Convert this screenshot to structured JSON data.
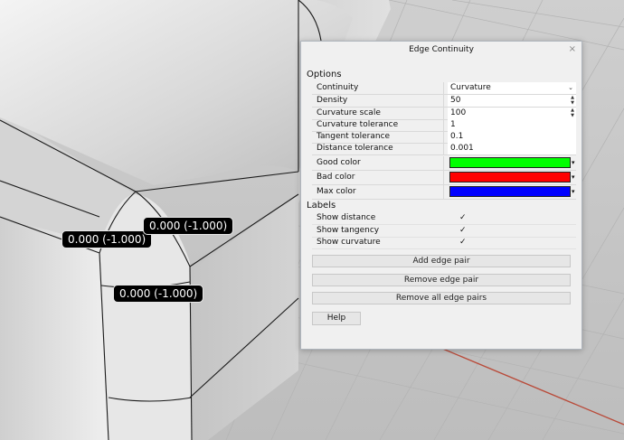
{
  "viewport": {
    "labels": [
      "0.000 (-1.000)",
      "0.000 (-1.000)",
      "0.000 (-1.000)"
    ]
  },
  "dialog": {
    "title": "Edge Continuity",
    "close_glyph": "×",
    "options_header": "Options",
    "options": [
      {
        "label": "Continuity",
        "value": "Curvature",
        "control": "dropdown"
      },
      {
        "label": "Density",
        "value": "50",
        "control": "spinner"
      },
      {
        "label": "Curvature scale",
        "value": "100",
        "control": "spinner"
      },
      {
        "label": "Curvature tolerance",
        "value": "1",
        "control": "text"
      },
      {
        "label": "Tangent tolerance",
        "value": "0.1",
        "control": "text"
      },
      {
        "label": "Distance tolerance",
        "value": "0.001",
        "control": "text"
      }
    ],
    "colors": [
      {
        "label": "Good color",
        "color": "#00ff00"
      },
      {
        "label": "Bad color",
        "color": "#ff0000"
      },
      {
        "label": "Max color",
        "color": "#0000ff"
      }
    ],
    "labels_header": "Labels",
    "labels": [
      {
        "label": "Show distance",
        "checked": true
      },
      {
        "label": "Show tangency",
        "checked": true
      },
      {
        "label": "Show curvature",
        "checked": true
      }
    ],
    "buttons": {
      "add": "Add edge pair",
      "remove": "Remove edge pair",
      "remove_all": "Remove all edge pairs",
      "help": "Help"
    }
  },
  "glyphs": {
    "dropdown": "⌄",
    "spin_up": "▲",
    "spin_down": "▼",
    "color_caret": "▾",
    "check": "✓"
  }
}
